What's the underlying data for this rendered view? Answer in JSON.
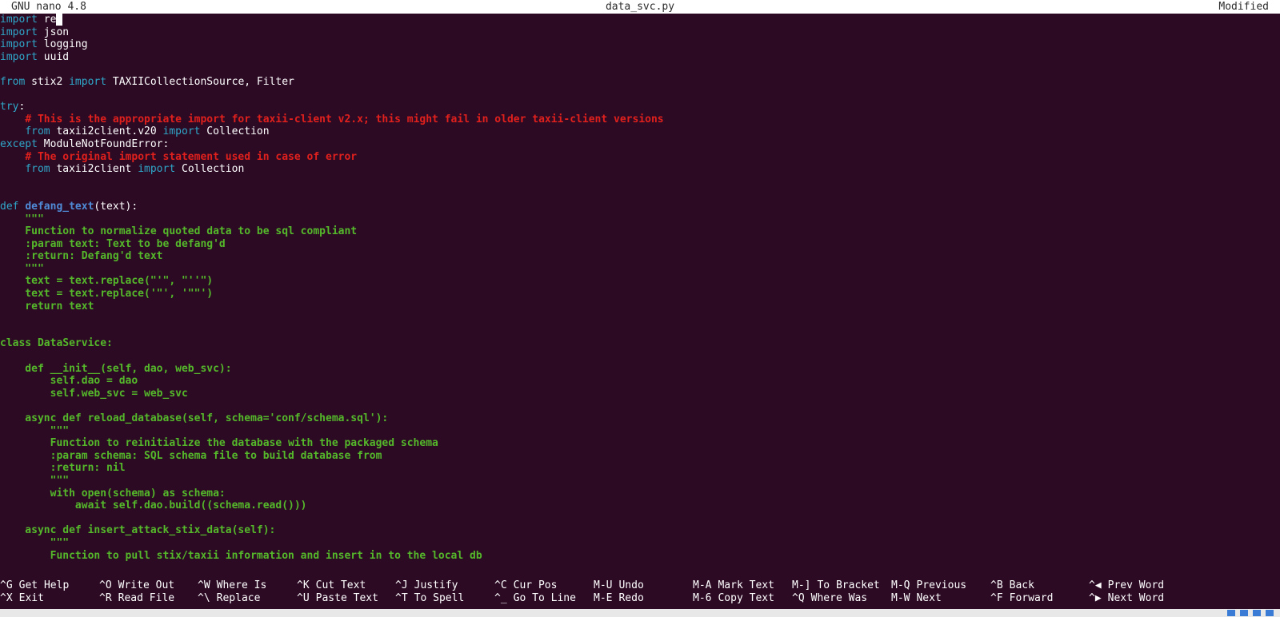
{
  "titlebar": {
    "app": "GNU nano 4.8",
    "file": "data_svc.py",
    "status": "Modified"
  },
  "editor": {
    "lines": [
      [
        {
          "t": "import",
          "c": "kw"
        },
        {
          "t": " "
        },
        {
          "t": "re"
        },
        {
          "t": " ",
          "c": "cursor"
        }
      ],
      [
        {
          "t": "import",
          "c": "kw"
        },
        {
          "t": " json"
        }
      ],
      [
        {
          "t": "import",
          "c": "kw"
        },
        {
          "t": " logging"
        }
      ],
      [
        {
          "t": "import",
          "c": "kw"
        },
        {
          "t": " uuid"
        }
      ],
      [],
      [
        {
          "t": "from",
          "c": "kw"
        },
        {
          "t": " stix2 "
        },
        {
          "t": "import",
          "c": "kw"
        },
        {
          "t": " TAXIICollectionSource, Filter"
        }
      ],
      [],
      [
        {
          "t": "try",
          "c": "kw"
        },
        {
          "t": ":"
        }
      ],
      [
        {
          "t": "    "
        },
        {
          "t": "# This is the appropriate import for taxii-client v2.x; this might fail in older taxii-client versions",
          "c": "cm"
        }
      ],
      [
        {
          "t": "    "
        },
        {
          "t": "from",
          "c": "kw"
        },
        {
          "t": " taxii2client.v20 "
        },
        {
          "t": "import",
          "c": "kw"
        },
        {
          "t": " Collection"
        }
      ],
      [
        {
          "t": "except",
          "c": "kw"
        },
        {
          "t": " ModuleNotFoundError:"
        }
      ],
      [
        {
          "t": "    "
        },
        {
          "t": "# The original import statement used in case of error",
          "c": "cm"
        }
      ],
      [
        {
          "t": "    "
        },
        {
          "t": "from",
          "c": "kw"
        },
        {
          "t": " taxii2client "
        },
        {
          "t": "import",
          "c": "kw"
        },
        {
          "t": " Collection"
        }
      ],
      [],
      [],
      [
        {
          "t": "def",
          "c": "kw"
        },
        {
          "t": " "
        },
        {
          "t": "defang_text",
          "c": "fn"
        },
        {
          "t": "(text):"
        }
      ],
      [
        {
          "t": "    \"\"\"",
          "c": "gr"
        }
      ],
      [
        {
          "t": "    Function to normalize quoted data to be sql compliant",
          "c": "gr"
        }
      ],
      [
        {
          "t": "    :param text: Text to be defang'd",
          "c": "gr"
        }
      ],
      [
        {
          "t": "    :return: Defang'd text",
          "c": "gr"
        }
      ],
      [
        {
          "t": "    \"\"\"",
          "c": "gr"
        }
      ],
      [
        {
          "t": "    text = text.replace(\"'\", \"''\")",
          "c": "gr"
        }
      ],
      [
        {
          "t": "    text = text.replace('\"', '\"\"')",
          "c": "gr"
        }
      ],
      [
        {
          "t": "    return text",
          "c": "gr"
        }
      ],
      [],
      [],
      [
        {
          "t": "class DataService:",
          "c": "gr"
        }
      ],
      [],
      [
        {
          "t": "    def __init__(self, dao, web_svc):",
          "c": "gr"
        }
      ],
      [
        {
          "t": "        self.dao = dao",
          "c": "gr"
        }
      ],
      [
        {
          "t": "        self.web_svc = web_svc",
          "c": "gr"
        }
      ],
      [],
      [
        {
          "t": "    async def reload_database(self, schema='conf/schema.sql'):",
          "c": "gr"
        }
      ],
      [
        {
          "t": "        \"\"\"",
          "c": "gr"
        }
      ],
      [
        {
          "t": "        Function to reinitialize the database with the packaged schema",
          "c": "gr"
        }
      ],
      [
        {
          "t": "        :param schema: SQL schema file to build database from",
          "c": "gr"
        }
      ],
      [
        {
          "t": "        :return: nil",
          "c": "gr"
        }
      ],
      [
        {
          "t": "        \"\"\"",
          "c": "gr"
        }
      ],
      [
        {
          "t": "        with open(schema) as schema:",
          "c": "gr"
        }
      ],
      [
        {
          "t": "            await self.dao.build((schema.read()))",
          "c": "gr"
        }
      ],
      [],
      [
        {
          "t": "    async def insert_attack_stix_data(self):",
          "c": "gr"
        }
      ],
      [
        {
          "t": "        \"\"\"",
          "c": "gr"
        }
      ],
      [
        {
          "t": "        Function to pull stix/taxii information and insert in to the local db",
          "c": "gr"
        }
      ]
    ]
  },
  "shortcuts": [
    {
      "key": "^G",
      "label": "Get Help"
    },
    {
      "key": "^O",
      "label": "Write Out"
    },
    {
      "key": "^W",
      "label": "Where Is"
    },
    {
      "key": "^K",
      "label": "Cut Text"
    },
    {
      "key": "^J",
      "label": "Justify"
    },
    {
      "key": "^C",
      "label": "Cur Pos"
    },
    {
      "key": "M-U",
      "label": "Undo"
    },
    {
      "key": "M-A",
      "label": "Mark Text"
    },
    {
      "key": "M-]",
      "label": "To Bracket"
    },
    {
      "key": "M-Q",
      "label": "Previous"
    },
    {
      "key": "^B",
      "label": "Back"
    },
    {
      "key": "^◀",
      "label": "Prev Word"
    },
    {
      "key": "^X",
      "label": "Exit"
    },
    {
      "key": "^R",
      "label": "Read File"
    },
    {
      "key": "^\\",
      "label": "Replace"
    },
    {
      "key": "^U",
      "label": "Paste Text"
    },
    {
      "key": "^T",
      "label": "To Spell"
    },
    {
      "key": "^_",
      "label": "Go To Line"
    },
    {
      "key": "M-E",
      "label": "Redo"
    },
    {
      "key": "M-6",
      "label": "Copy Text"
    },
    {
      "key": "^Q",
      "label": "Where Was"
    },
    {
      "key": "M-W",
      "label": "Next"
    },
    {
      "key": "^F",
      "label": "Forward"
    },
    {
      "key": "^▶",
      "label": "Next Word"
    }
  ]
}
